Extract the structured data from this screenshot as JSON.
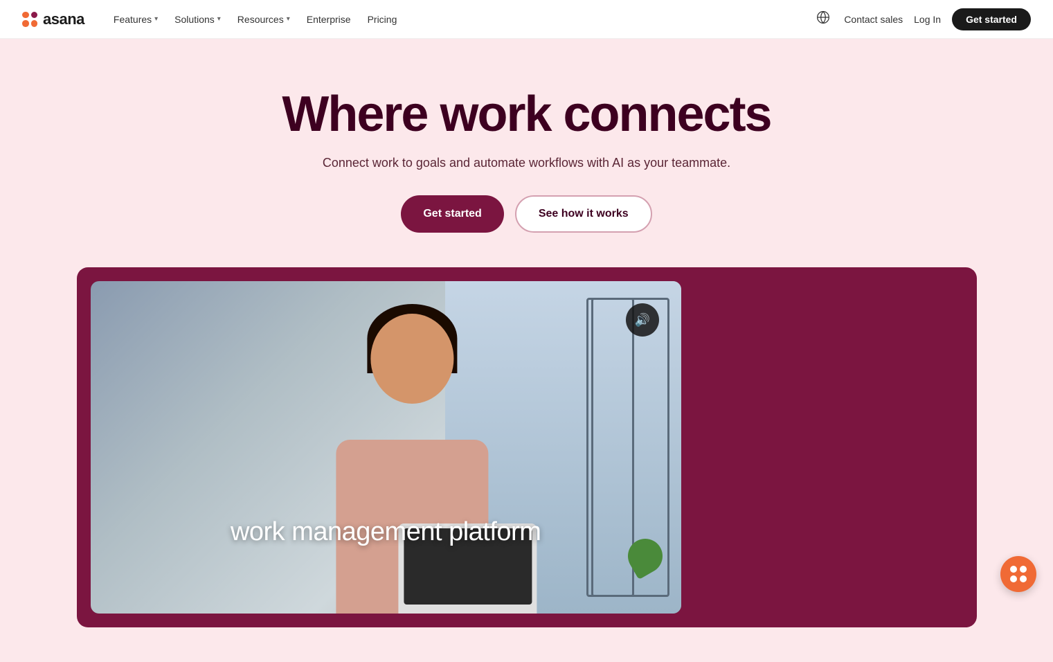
{
  "brand": {
    "name": "asana",
    "logo_alt": "Asana logo"
  },
  "nav": {
    "links": [
      {
        "label": "Features",
        "has_dropdown": true
      },
      {
        "label": "Solutions",
        "has_dropdown": true
      },
      {
        "label": "Resources",
        "has_dropdown": true
      },
      {
        "label": "Enterprise",
        "has_dropdown": false
      },
      {
        "label": "Pricing",
        "has_dropdown": false
      }
    ],
    "contact_sales": "Contact sales",
    "login": "Log In",
    "get_started": "Get started"
  },
  "hero": {
    "title": "Where work connects",
    "subtitle": "Connect work to goals and automate workflows with AI as your teammate.",
    "cta_primary": "Get started",
    "cta_secondary": "See how it works"
  },
  "video": {
    "overlay_text": "work management platform",
    "mute_icon": "🔊"
  },
  "colors": {
    "hero_bg": "#fce8eb",
    "brand_dark": "#7b1540",
    "title_color": "#3d0020",
    "nav_bg": "#ffffff",
    "nav_cta_bg": "#1a1a1a"
  }
}
